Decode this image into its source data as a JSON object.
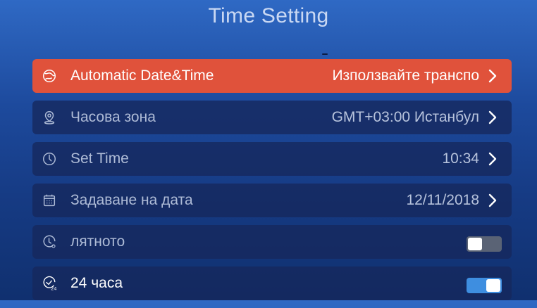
{
  "header": {
    "title": "Time Setting"
  },
  "colors": {
    "selected_row": "#e0523b",
    "row_bg": "#16285c",
    "toggle_on": "#3e8ee0",
    "toggle_off": "#5a6375"
  },
  "rows": [
    {
      "label": "Automatic Date&Time",
      "value": "Използвайте транспо",
      "icon": "globe-icon",
      "type": "chevron",
      "selected": true
    },
    {
      "label": "Часова зона",
      "value": "GMT+03:00 Истанбул",
      "icon": "location-pin-icon",
      "type": "chevron"
    },
    {
      "label": "Set Time",
      "value": "10:34",
      "icon": "clock-icon",
      "type": "chevron"
    },
    {
      "label": "Задаване на дата",
      "value": "12/11/2018",
      "icon": "calendar-icon",
      "type": "chevron"
    },
    {
      "label": "лятното",
      "icon": "daylight-clock-icon",
      "type": "toggle",
      "on": false
    },
    {
      "label": "24 часа",
      "icon": "clock-24-icon",
      "type": "toggle",
      "on": true
    }
  ]
}
